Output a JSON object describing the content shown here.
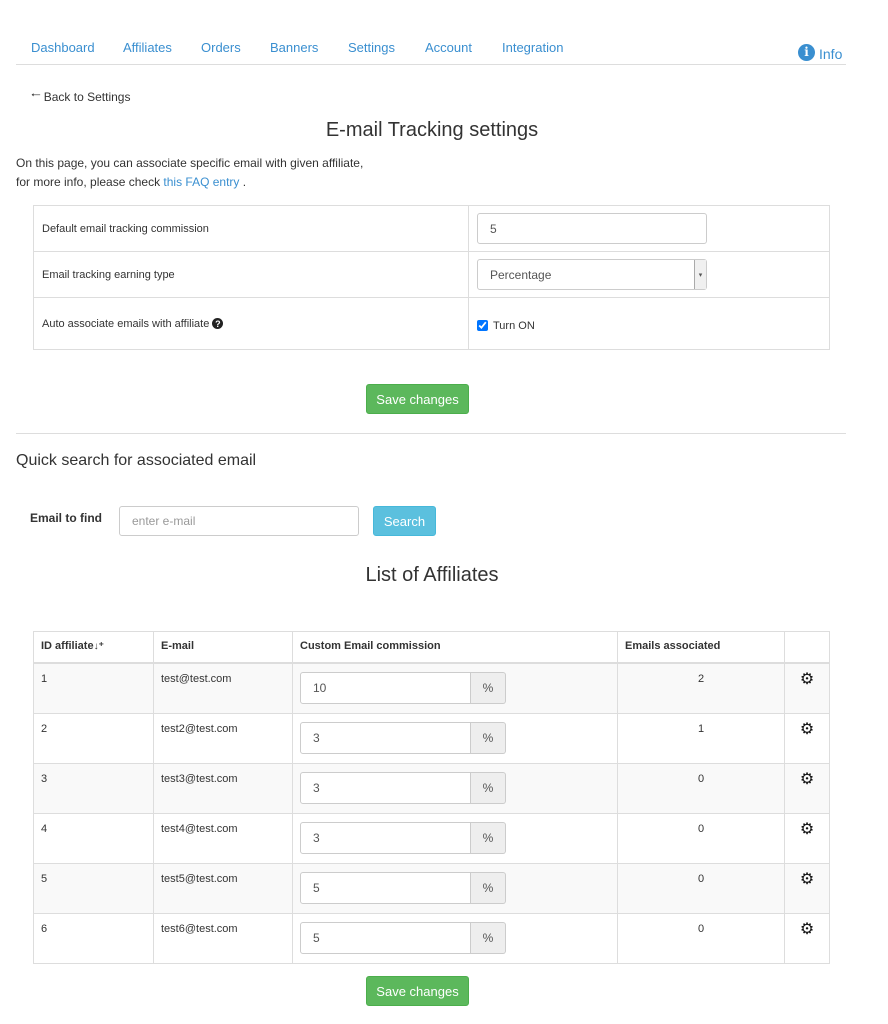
{
  "nav": {
    "items": [
      "Dashboard",
      "Affiliates",
      "Orders",
      "Banners",
      "Settings",
      "Account",
      "Integration"
    ],
    "info": "Info"
  },
  "back": "Back to Settings",
  "title": "E-mail Tracking settings",
  "intro": {
    "line1": "On this page, you can associate specific email with given affiliate,",
    "line2_prefix": "for more info, please check ",
    "link": "this FAQ entry",
    "line2_suffix": " ."
  },
  "settings": {
    "commission_label": "Default email tracking commission",
    "commission_value": "5",
    "earning_label": "Email tracking earning type",
    "earning_value": "Percentage",
    "auto_label": "Auto associate emails with affiliate",
    "auto_checkbox": "Turn ON",
    "auto_checked": true
  },
  "save_label": "Save changes",
  "search": {
    "heading": "Quick search for associated email",
    "label": "Email to find",
    "placeholder": "enter e-mail",
    "button": "Search"
  },
  "list_title": "List of Affiliates",
  "table": {
    "headers": [
      "ID affiliate",
      "E-mail",
      "Custom Email commission",
      "Emails associated",
      ""
    ],
    "unit": "%",
    "rows": [
      {
        "id": "1",
        "email": "test@test.com",
        "commission": "10",
        "associated": "2"
      },
      {
        "id": "2",
        "email": "test2@test.com",
        "commission": "3",
        "associated": "1"
      },
      {
        "id": "3",
        "email": "test3@test.com",
        "commission": "3",
        "associated": "0"
      },
      {
        "id": "4",
        "email": "test4@test.com",
        "commission": "3",
        "associated": "0"
      },
      {
        "id": "5",
        "email": "test5@test.com",
        "commission": "5",
        "associated": "0"
      },
      {
        "id": "6",
        "email": "test6@test.com",
        "commission": "5",
        "associated": "0"
      }
    ]
  },
  "colors": {
    "link": "#3a8fd0",
    "success": "#5cb85c",
    "info": "#5bc0de"
  }
}
